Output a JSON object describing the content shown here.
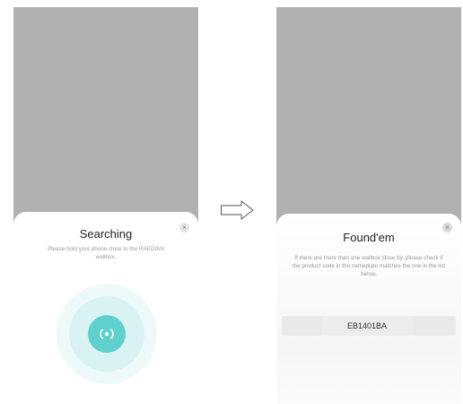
{
  "left_screen": {
    "title": "Searching",
    "subtitle": "Please hold your phone close to the RAEDIAN wallbox.",
    "close_symbol": "×",
    "icon": "nfc-signal-icon"
  },
  "right_screen": {
    "title": "Found'em",
    "subtitle": "If there are more than one wallbox close by, please check if the product code in the nameplate matches the one in the list below.",
    "close_symbol": "×",
    "devices": [
      "EB1401BA"
    ]
  },
  "colors": {
    "accent": "#5ed0cd",
    "ring_light": "#eefafa",
    "ring_mid": "#d9f3f3",
    "overlay": "#b1b1b1"
  },
  "flow_arrow_icon": "arrow-right-icon"
}
